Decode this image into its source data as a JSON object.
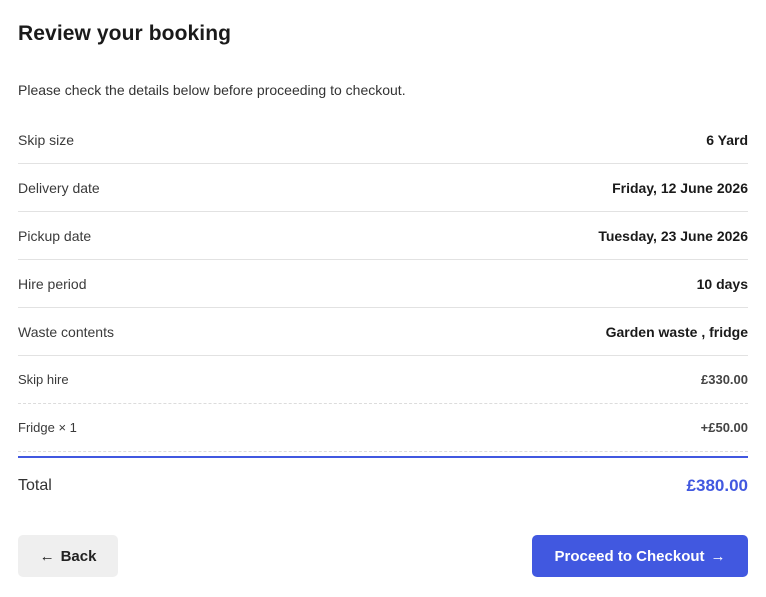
{
  "page": {
    "title": "Review your booking",
    "intro": "Please check the details below before proceeding to checkout."
  },
  "details": [
    {
      "label": "Skip size",
      "value": "6 Yard"
    },
    {
      "label": "Delivery date",
      "value": "Friday, 12 June 2026"
    },
    {
      "label": "Pickup date",
      "value": "Tuesday, 23 June 2026"
    },
    {
      "label": "Hire period",
      "value": "10 days"
    },
    {
      "label": "Waste contents",
      "value": "Garden waste , fridge"
    }
  ],
  "prices": [
    {
      "label": "Skip hire",
      "value": "£330.00"
    },
    {
      "label": "Fridge × 1",
      "value": "+£50.00"
    }
  ],
  "total": {
    "label": "Total",
    "value": "£380.00"
  },
  "actions": {
    "back_icon": "←",
    "back_label": "Back",
    "checkout_label": "Proceed to Checkout",
    "checkout_icon": "→"
  },
  "colors": {
    "accent": "#4158e0",
    "secondary_button": "#efefef"
  }
}
